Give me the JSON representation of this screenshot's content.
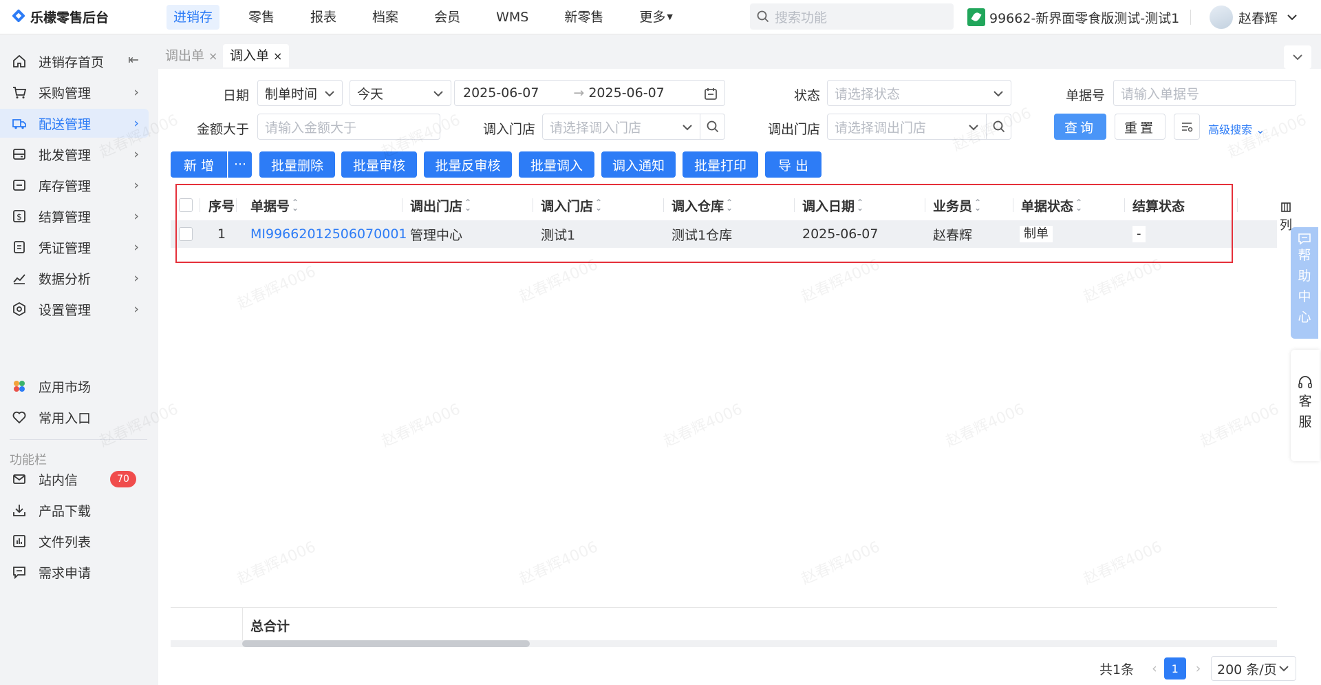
{
  "app": {
    "title": "乐檬零售后台"
  },
  "topnav": [
    "进销存",
    "零售",
    "报表",
    "档案",
    "会员",
    "WMS",
    "新零售",
    "更多"
  ],
  "search": {
    "placeholder": "搜索功能"
  },
  "store": {
    "name": "99662-新界面零食版测试-测试1"
  },
  "user": {
    "name": "赵春辉"
  },
  "sidebar": {
    "items": [
      {
        "label": "进销存首页",
        "icon": "home-icon"
      },
      {
        "label": "采购管理",
        "icon": "cart-icon"
      },
      {
        "label": "配送管理",
        "icon": "truck-icon"
      },
      {
        "label": "批发管理",
        "icon": "wholesale-icon"
      },
      {
        "label": "库存管理",
        "icon": "inventory-icon"
      },
      {
        "label": "结算管理",
        "icon": "settlement-icon"
      },
      {
        "label": "凭证管理",
        "icon": "voucher-icon"
      },
      {
        "label": "数据分析",
        "icon": "chart-icon"
      },
      {
        "label": "设置管理",
        "icon": "settings-icon"
      }
    ],
    "app_market": "应用市场",
    "favorites": "常用入口",
    "section_label": "功能栏",
    "message": "站内信",
    "message_badge": "70",
    "download": "产品下载",
    "files": "文件列表",
    "request": "需求申请"
  },
  "tabs": [
    {
      "label": "调出单",
      "close": "×"
    },
    {
      "label": "调入单",
      "close": "×"
    }
  ],
  "filters": {
    "date_label": "日期",
    "date_type": "制单时间",
    "date_range": "今天",
    "date_start": "2025-06-07",
    "date_arrow": "→",
    "date_end": "2025-06-07",
    "status_label": "状态",
    "status_placeholder": "请选择状态",
    "bill_no_label": "单据号",
    "bill_no_placeholder": "请输入单据号",
    "amount_label": "金额大于",
    "amount_placeholder": "请输入金额大于",
    "in_store_label": "调入门店",
    "in_store_placeholder": "请选择调入门店",
    "out_store_label": "调出门店",
    "out_store_placeholder": "请选择调出门店",
    "query": "查询",
    "reset": "重置",
    "advanced": "高级搜索"
  },
  "actions": {
    "add": "新 增",
    "more": "···",
    "batch_delete": "批量删除",
    "batch_audit": "批量审核",
    "batch_unaudit": "批量反审核",
    "batch_transfer_in": "批量调入",
    "transfer_notice": "调入通知",
    "batch_print": "批量打印",
    "export": "导 出"
  },
  "table": {
    "columns": [
      "序号",
      "单据号",
      "调出门店",
      "调入门店",
      "调入仓库",
      "调入日期",
      "业务员",
      "单据状态",
      "结算状态"
    ],
    "rows": [
      {
        "seq": "1",
        "bill_no": "MI99662012506070001",
        "out_store": "管理中心",
        "in_store": "测试1",
        "warehouse": "测试1仓库",
        "date": "2025-06-07",
        "salesman": "赵春辉",
        "status": "制单",
        "settle": "-"
      }
    ],
    "column_setting": "列",
    "total_label": "总合计"
  },
  "pagination": {
    "total": "共1条",
    "current": "1",
    "page_size": "200 条/页"
  },
  "float": {
    "help": [
      "帮",
      "助",
      "中",
      "心"
    ],
    "service": [
      "客",
      "服"
    ]
  },
  "watermark": "赵春辉4006",
  "colors": {
    "primary": "#2d7cf6",
    "highlight_box": "#e5303a",
    "badge": "#f04c4c"
  }
}
